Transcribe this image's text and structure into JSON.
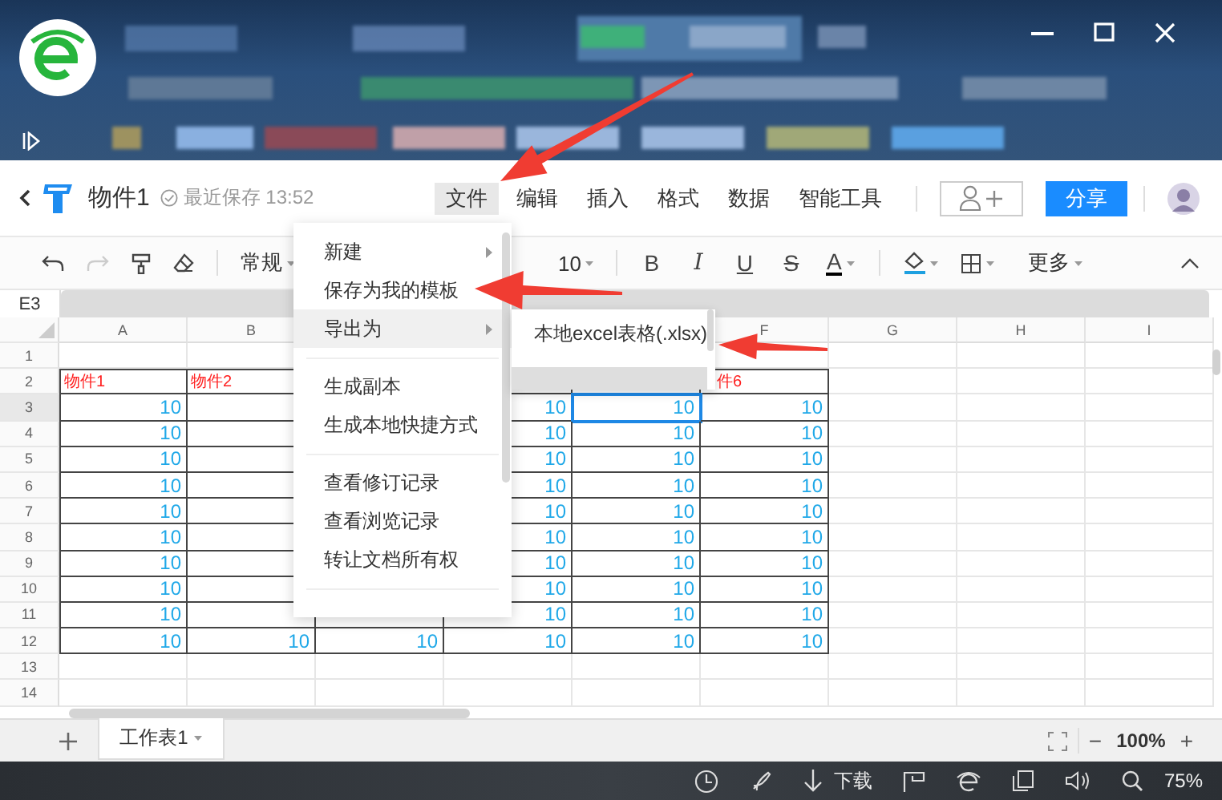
{
  "header": {
    "title": "物件1",
    "save_status": "最近保存 13:52",
    "menu": [
      {
        "label": "文件",
        "selected": true
      },
      {
        "label": "编辑",
        "selected": false
      },
      {
        "label": "插入",
        "selected": false
      },
      {
        "label": "格式",
        "selected": false
      },
      {
        "label": "数据",
        "selected": false
      },
      {
        "label": "智能工具",
        "selected": false
      }
    ],
    "share": "分享"
  },
  "toolbar": {
    "undo_disabled": false,
    "redo_disabled": true,
    "number_format": "常规",
    "font_size": "10",
    "bold": "B",
    "italic": "I",
    "underline": "U",
    "strike": "S",
    "font_color": "A",
    "more": "更多"
  },
  "formula_bar": {
    "cell_ref": "E3"
  },
  "table": {
    "columns": [
      "A",
      "B",
      null,
      null,
      null,
      "F",
      "G",
      "H",
      "I"
    ],
    "rows": [
      {
        "header": "1"
      },
      {
        "header": "2",
        "cells": [
          {
            "text": "物件1",
            "kind": "label",
            "selected": false
          },
          {
            "text": "物件2",
            "kind": "label",
            "selected": false
          },
          null,
          null,
          null,
          {
            "text": "件6",
            "kind": "label",
            "selected": false
          }
        ]
      },
      {
        "header": "3",
        "cells": [
          {
            "text": "10",
            "kind": "number",
            "selected": false
          },
          null,
          null,
          {
            "text": "10",
            "kind": "number",
            "selected": false
          },
          {
            "text": "10",
            "kind": "number",
            "selected": true
          },
          {
            "text": "10",
            "kind": "number",
            "selected": false
          }
        ]
      },
      {
        "header": "4",
        "cells": [
          {
            "text": "10",
            "kind": "number",
            "selected": false
          },
          null,
          null,
          {
            "text": "10",
            "kind": "number",
            "selected": false
          },
          {
            "text": "10",
            "kind": "number",
            "selected": false
          },
          {
            "text": "10",
            "kind": "number",
            "selected": false
          }
        ]
      },
      {
        "header": "5",
        "cells": [
          {
            "text": "10",
            "kind": "number",
            "selected": false
          },
          null,
          null,
          {
            "text": "10",
            "kind": "number",
            "selected": false
          },
          {
            "text": "10",
            "kind": "number",
            "selected": false
          },
          {
            "text": "10",
            "kind": "number",
            "selected": false
          }
        ]
      },
      {
        "header": "6",
        "cells": [
          {
            "text": "10",
            "kind": "number",
            "selected": false
          },
          null,
          null,
          {
            "text": "10",
            "kind": "number",
            "selected": false
          },
          {
            "text": "10",
            "kind": "number",
            "selected": false
          },
          {
            "text": "10",
            "kind": "number",
            "selected": false
          }
        ]
      },
      {
        "header": "7",
        "cells": [
          {
            "text": "10",
            "kind": "number",
            "selected": false
          },
          null,
          null,
          {
            "text": "10",
            "kind": "number",
            "selected": false
          },
          {
            "text": "10",
            "kind": "number",
            "selected": false
          },
          {
            "text": "10",
            "kind": "number",
            "selected": false
          }
        ]
      },
      {
        "header": "8",
        "cells": [
          {
            "text": "10",
            "kind": "number",
            "selected": false
          },
          null,
          null,
          {
            "text": "10",
            "kind": "number",
            "selected": false
          },
          {
            "text": "10",
            "kind": "number",
            "selected": false
          },
          {
            "text": "10",
            "kind": "number",
            "selected": false
          }
        ]
      },
      {
        "header": "9",
        "cells": [
          {
            "text": "10",
            "kind": "number",
            "selected": false
          },
          null,
          null,
          {
            "text": "10",
            "kind": "number",
            "selected": false
          },
          {
            "text": "10",
            "kind": "number",
            "selected": false
          },
          {
            "text": "10",
            "kind": "number",
            "selected": false
          }
        ]
      },
      {
        "header": "10",
        "cells": [
          {
            "text": "10",
            "kind": "number",
            "selected": false
          },
          null,
          null,
          {
            "text": "10",
            "kind": "number",
            "selected": false
          },
          {
            "text": "10",
            "kind": "number",
            "selected": false
          },
          {
            "text": "10",
            "kind": "number",
            "selected": false
          }
        ]
      },
      {
        "header": "11",
        "cells": [
          {
            "text": "10",
            "kind": "number",
            "selected": false
          },
          null,
          null,
          {
            "text": "10",
            "kind": "number",
            "selected": false
          },
          {
            "text": "10",
            "kind": "number",
            "selected": false
          },
          {
            "text": "10",
            "kind": "number",
            "selected": false
          }
        ]
      },
      {
        "header": "12",
        "cells": [
          {
            "text": "10",
            "kind": "number",
            "selected": false
          },
          {
            "text": "10",
            "kind": "number",
            "selected": false
          },
          {
            "text": "10",
            "kind": "number",
            "selected": false
          },
          {
            "text": "10",
            "kind": "number",
            "selected": false
          },
          {
            "text": "10",
            "kind": "number",
            "selected": false
          },
          {
            "text": "10",
            "kind": "number",
            "selected": false
          }
        ]
      },
      {
        "header": "13"
      },
      {
        "header": "14"
      }
    ]
  },
  "file_menu": {
    "items": [
      {
        "kind": "item",
        "label": "新建",
        "has_submenu": true,
        "highlighted": false
      },
      {
        "kind": "item",
        "label": "保存为我的模板",
        "has_submenu": false,
        "highlighted": false
      },
      {
        "kind": "item",
        "label": "导出为",
        "has_submenu": true,
        "highlighted": true
      },
      {
        "kind": "separator"
      },
      {
        "kind": "item",
        "label": "生成副本",
        "has_submenu": false,
        "highlighted": false
      },
      {
        "kind": "item",
        "label": "生成本地快捷方式",
        "has_submenu": false,
        "highlighted": false
      },
      {
        "kind": "separator"
      },
      {
        "kind": "item",
        "label": "查看修订记录",
        "has_submenu": false,
        "highlighted": false
      },
      {
        "kind": "item",
        "label": "查看浏览记录",
        "has_submenu": false,
        "highlighted": false
      },
      {
        "kind": "item",
        "label": "转让文档所有权",
        "has_submenu": false,
        "highlighted": false
      },
      {
        "kind": "separator"
      }
    ]
  },
  "export_submenu": {
    "items": [
      {
        "label": "本地excel表格(.xlsx)"
      }
    ]
  },
  "sheet_tabs": [
    {
      "label": "工作表1",
      "selected": true
    }
  ],
  "zoom": {
    "minus": "−",
    "value": "100%",
    "plus": "+"
  },
  "taskbar": {
    "download": "下载",
    "zoom": "75%"
  }
}
